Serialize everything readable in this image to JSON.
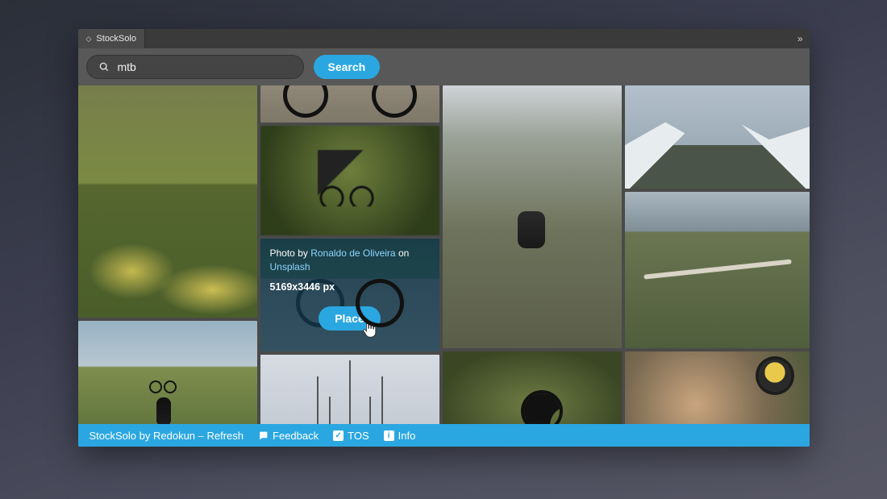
{
  "tab": {
    "title": "StockSolo"
  },
  "search": {
    "value": "mtb",
    "button": "Search",
    "placeholder": ""
  },
  "overlay": {
    "photo_by_prefix": "Photo by ",
    "author": "Ronaldo de Oliveira",
    "on_word": " on ",
    "source": "Unsplash",
    "dimensions": "5169x3446 px",
    "place_button": "Place"
  },
  "footer": {
    "brand_text": "StockSolo by Redokun",
    "dash": " – ",
    "refresh": "Refresh",
    "feedback": "Feedback",
    "tos": "TOS",
    "info": "Info"
  },
  "colors": {
    "accent": "#2aa7e1"
  }
}
